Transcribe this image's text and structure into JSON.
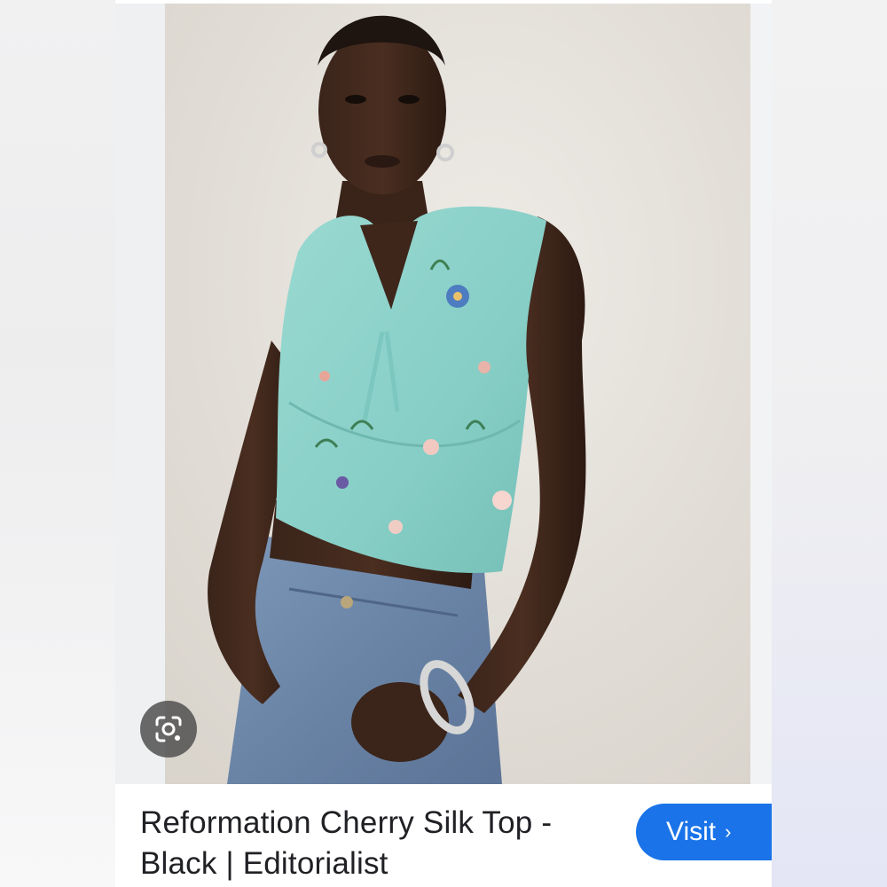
{
  "result": {
    "title": "Reformation Cherry Silk Top - Black | Editorialist",
    "visit_label": "Visit",
    "visit_chevron": "›"
  },
  "icons": {
    "lens": "google-lens-icon",
    "visit_chevron": "chevron-right-icon"
  },
  "colors": {
    "accent": "#1a73e8",
    "top_fabric": "#8fd3cc",
    "denim": "#6b86a8",
    "backdrop": "#e6e2dc"
  }
}
